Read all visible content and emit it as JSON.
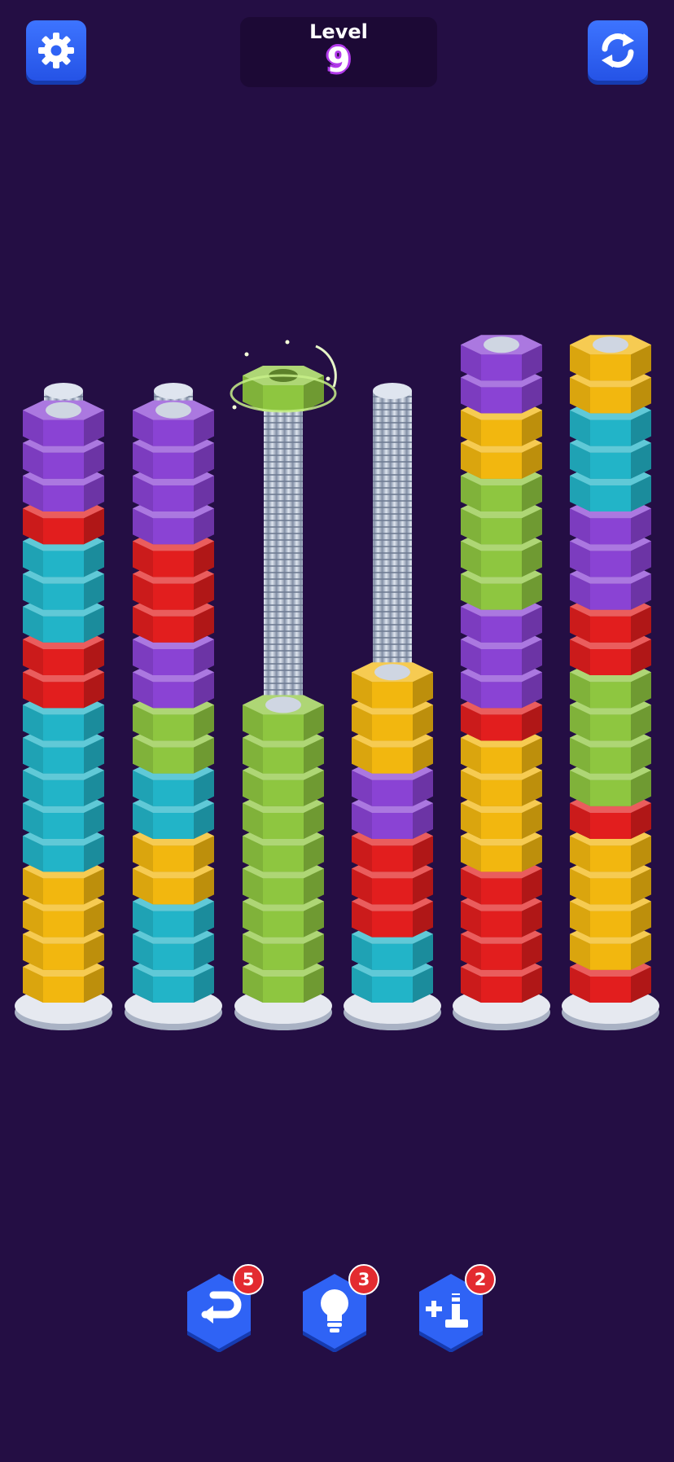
{
  "header": {
    "level_label": "Level",
    "level_number": "9",
    "settings_icon": "gear-icon",
    "restart_icon": "restart-icon"
  },
  "colors": {
    "background": "#240e44",
    "purple": "#8a43d4",
    "red": "#e21e1e",
    "teal": "#22b4c8",
    "yellow": "#f2b70f",
    "green": "#8ec640",
    "button_blue": "#2f63f5"
  },
  "board": {
    "selected_nut_color": "green",
    "bolts": [
      [
        "yellow",
        "yellow",
        "yellow",
        "yellow",
        "teal",
        "teal",
        "teal",
        "teal",
        "teal",
        "red",
        "red",
        "teal",
        "teal",
        "teal",
        "red",
        "purple",
        "purple",
        "purple"
      ],
      [
        "teal",
        "teal",
        "teal",
        "yellow",
        "yellow",
        "teal",
        "teal",
        "green",
        "green",
        "purple",
        "purple",
        "red",
        "red",
        "red",
        "purple",
        "purple",
        "purple",
        "purple"
      ],
      [
        "green",
        "green",
        "green",
        "green",
        "green",
        "green",
        "green",
        "green",
        "green"
      ],
      [
        "teal",
        "teal",
        "red",
        "red",
        "red",
        "purple",
        "purple",
        "yellow",
        "yellow",
        "yellow"
      ],
      [
        "red",
        "red",
        "red",
        "red",
        "yellow",
        "yellow",
        "yellow",
        "yellow",
        "red",
        "purple",
        "purple",
        "purple",
        "green",
        "green",
        "green",
        "green",
        "yellow",
        "yellow",
        "purple",
        "purple"
      ],
      [
        "red",
        "yellow",
        "yellow",
        "yellow",
        "yellow",
        "red",
        "green",
        "green",
        "green",
        "green",
        "red",
        "red",
        "purple",
        "purple",
        "purple",
        "teal",
        "teal",
        "teal",
        "yellow",
        "yellow"
      ]
    ]
  },
  "boosters": [
    {
      "name": "undo",
      "icon": "undo-icon",
      "count": "5"
    },
    {
      "name": "hint",
      "icon": "lightbulb-icon",
      "count": "3"
    },
    {
      "name": "add-bolt",
      "icon": "add-bolt-icon",
      "count": "2"
    }
  ]
}
